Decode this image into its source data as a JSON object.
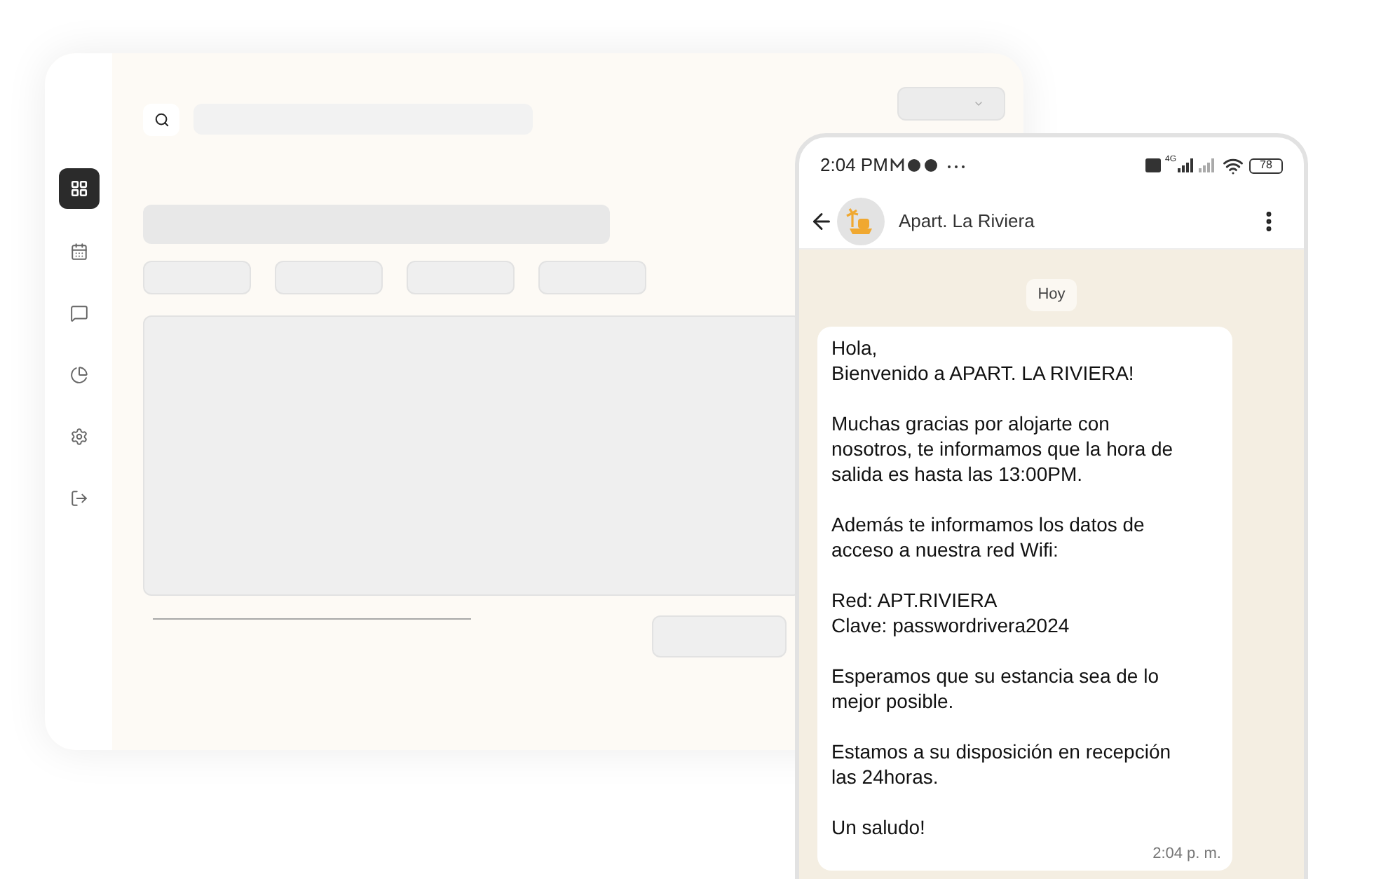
{
  "sidebar": {
    "items": [
      {
        "selected": true
      },
      {
        "selected": false
      },
      {
        "selected": false
      },
      {
        "selected": false
      },
      {
        "selected": false
      },
      {
        "selected": false
      }
    ]
  },
  "phone": {
    "status_bar": {
      "time": "2:04 PM",
      "network": "4G",
      "battery": "78"
    },
    "chat_header": {
      "name": "Apart. La Riviera"
    },
    "date_chip": "Hoy",
    "message": {
      "paragraphs": [
        [
          "Hola,",
          "Bienvenido a APART. LA RIVIERA!"
        ],
        [
          "Muchas gracias por alojarte con",
          "nosotros, te informamos que la hora de",
          "salida es hasta las 13:00PM."
        ],
        [
          "Además te informamos los datos de",
          "acceso a nuestra red Wifi:"
        ],
        [
          "Red: APT.RIVIERA",
          "Clave: passwordrivera2024"
        ],
        [
          "Esperamos que su estancia sea de lo",
          "mejor posible."
        ],
        [
          "Estamos a su disposición en recepción",
          "las 24horas."
        ],
        [
          "Un saludo!"
        ]
      ],
      "time": "2:04 p. m."
    }
  }
}
